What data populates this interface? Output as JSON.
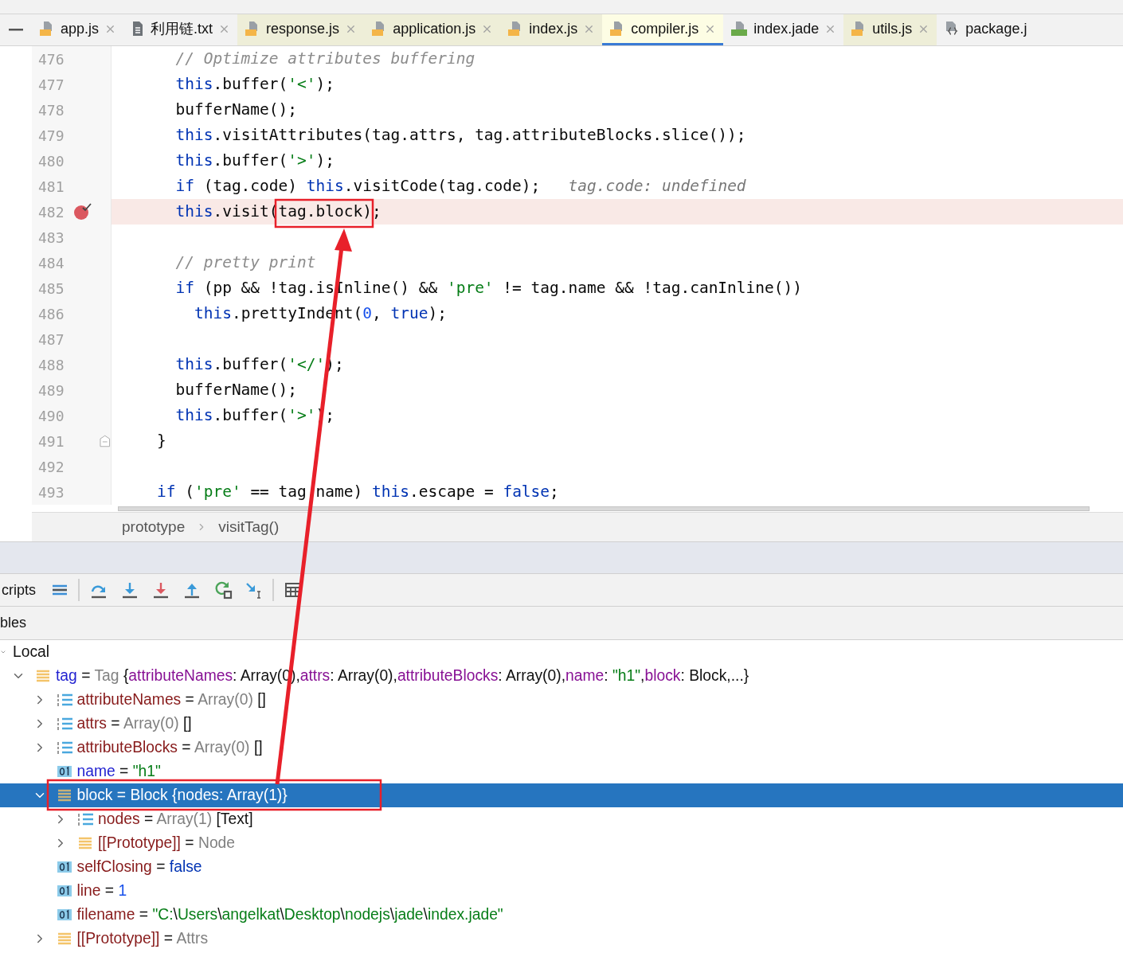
{
  "tabs": [
    {
      "label": "app.js",
      "kind": "js",
      "color": "#f2f2f2",
      "selected": false,
      "closable": true
    },
    {
      "label": "利用链.txt",
      "kind": "txt",
      "color": "#f2f2f2",
      "selected": false,
      "closable": true
    },
    {
      "label": "response.js",
      "kind": "js",
      "color": "#eeeed8",
      "selected": false,
      "closable": true
    },
    {
      "label": "application.js",
      "kind": "js",
      "color": "#eeeed8",
      "selected": false,
      "closable": true
    },
    {
      "label": "index.js",
      "kind": "js",
      "color": "#eeeed8",
      "selected": false,
      "closable": true
    },
    {
      "label": "compiler.js",
      "kind": "js",
      "color": "#fdfde4",
      "selected": true,
      "closable": true
    },
    {
      "label": "index.jade",
      "kind": "jade",
      "color": "#f2f2f2",
      "selected": false,
      "closable": true
    },
    {
      "label": "utils.js",
      "kind": "js",
      "color": "#eeeed8",
      "selected": false,
      "closable": true
    },
    {
      "label": "package.j",
      "kind": "json",
      "color": "#f2f2f2",
      "selected": false,
      "closable": false
    }
  ],
  "code_lines": [
    {
      "number": "476",
      "breakpoint": false,
      "fold": false,
      "segments": [
        {
          "text": "      // Optimize attributes buffering",
          "kind": "comment"
        }
      ]
    },
    {
      "number": "477",
      "breakpoint": false,
      "fold": false,
      "segments": [
        {
          "text": "      this",
          "kind": "keyword"
        },
        {
          "text": ".buffer(",
          "kind": "plain"
        },
        {
          "text": "'<'",
          "kind": "string"
        },
        {
          "text": ");",
          "kind": "plain"
        }
      ]
    },
    {
      "number": "478",
      "breakpoint": false,
      "fold": false,
      "segments": [
        {
          "text": "      bufferName();",
          "kind": "plain"
        }
      ]
    },
    {
      "number": "479",
      "breakpoint": false,
      "fold": false,
      "segments": [
        {
          "text": "      this",
          "kind": "keyword"
        },
        {
          "text": ".visitAttributes(tag.attrs, tag.attributeBlocks.slice());",
          "kind": "plain"
        }
      ]
    },
    {
      "number": "480",
      "breakpoint": false,
      "fold": false,
      "segments": [
        {
          "text": "      this",
          "kind": "keyword"
        },
        {
          "text": ".buffer(",
          "kind": "plain"
        },
        {
          "text": "'>'",
          "kind": "string"
        },
        {
          "text": ");",
          "kind": "plain"
        }
      ]
    },
    {
      "number": "481",
      "breakpoint": false,
      "fold": false,
      "segments": [
        {
          "text": "      if",
          "kind": "keyword"
        },
        {
          "text": " (tag.code) ",
          "kind": "plain"
        },
        {
          "text": "this",
          "kind": "keyword"
        },
        {
          "text": ".visitCode(tag.code);",
          "kind": "plain"
        },
        {
          "text": "   tag.code: undefined",
          "kind": "hint"
        }
      ]
    },
    {
      "number": "482",
      "breakpoint": true,
      "fold": false,
      "segments": [
        {
          "text": "      this",
          "kind": "keyword"
        },
        {
          "text": ".visit(tag.block);",
          "kind": "plain"
        }
      ]
    },
    {
      "number": "483",
      "breakpoint": false,
      "fold": false
    },
    {
      "number": "484",
      "breakpoint": false,
      "fold": false,
      "segments": [
        {
          "text": "      // pretty print",
          "kind": "comment"
        }
      ]
    },
    {
      "number": "485",
      "breakpoint": false,
      "fold": false,
      "segments": [
        {
          "text": "      if",
          "kind": "keyword"
        },
        {
          "text": " (pp && !tag.isInline() && ",
          "kind": "plain"
        },
        {
          "text": "'pre'",
          "kind": "string"
        },
        {
          "text": " != tag.name && !tag.canInline())",
          "kind": "plain"
        }
      ]
    },
    {
      "number": "486",
      "breakpoint": false,
      "fold": false,
      "segments": [
        {
          "text": "        this",
          "kind": "keyword"
        },
        {
          "text": ".prettyIndent(",
          "kind": "plain"
        },
        {
          "text": "0",
          "kind": "number"
        },
        {
          "text": ", ",
          "kind": "plain"
        },
        {
          "text": "true",
          "kind": "keyword"
        },
        {
          "text": ");",
          "kind": "plain"
        }
      ]
    },
    {
      "number": "487",
      "breakpoint": false,
      "fold": false
    },
    {
      "number": "488",
      "breakpoint": false,
      "fold": false,
      "segments": [
        {
          "text": "      this",
          "kind": "keyword"
        },
        {
          "text": ".buffer(",
          "kind": "plain"
        },
        {
          "text": "'</'",
          "kind": "string"
        },
        {
          "text": ");",
          "kind": "plain"
        }
      ]
    },
    {
      "number": "489",
      "breakpoint": false,
      "fold": false,
      "segments": [
        {
          "text": "      bufferName();",
          "kind": "plain"
        }
      ]
    },
    {
      "number": "490",
      "breakpoint": false,
      "fold": false,
      "segments": [
        {
          "text": "      this",
          "kind": "keyword"
        },
        {
          "text": ".buffer(",
          "kind": "plain"
        },
        {
          "text": "'>'",
          "kind": "string"
        },
        {
          "text": ");",
          "kind": "plain"
        }
      ]
    },
    {
      "number": "491",
      "breakpoint": false,
      "fold": true,
      "segments": [
        {
          "text": "    }",
          "kind": "plain"
        }
      ]
    },
    {
      "number": "492",
      "breakpoint": false,
      "fold": false
    },
    {
      "number": "493",
      "breakpoint": false,
      "fold": false,
      "segments": [
        {
          "text": "    if",
          "kind": "keyword"
        },
        {
          "text": " (",
          "kind": "plain"
        },
        {
          "text": "'pre'",
          "kind": "string"
        },
        {
          "text": " == tag.name) ",
          "kind": "plain"
        },
        {
          "text": "this",
          "kind": "keyword"
        },
        {
          "text": ".escape = ",
          "kind": "plain"
        },
        {
          "text": "false",
          "kind": "keyword"
        },
        {
          "text": ";",
          "kind": "plain"
        }
      ]
    }
  ],
  "breadcrumb": [
    "prototype",
    "visitTag()"
  ],
  "frames_label": "cripts",
  "variables_header": "bles",
  "variables": [
    {
      "segments": [
        {
          "text": "Local",
          "kind": "plain"
        }
      ],
      "expanded": true,
      "selected": false,
      "children": [
        {
          "kind": "object",
          "expanded": true,
          "selected": false,
          "segments": [
            {
              "text": "tag",
              "kind": "local"
            },
            {
              "text": " = ",
              "kind": "plain"
            },
            {
              "text": "Tag ",
              "kind": "type"
            },
            {
              "text": "{",
              "kind": "plain"
            },
            {
              "text": "attributeNames",
              "kind": "prop"
            },
            {
              "text": ": Array(0),",
              "kind": "plain"
            },
            {
              "text": "attrs",
              "kind": "prop"
            },
            {
              "text": ": Array(0),",
              "kind": "plain"
            },
            {
              "text": "attributeBlocks",
              "kind": "prop"
            },
            {
              "text": ": Array(0),",
              "kind": "plain"
            },
            {
              "text": "name",
              "kind": "prop"
            },
            {
              "text": ": ",
              "kind": "plain"
            },
            {
              "text": "\"h1\"",
              "kind": "string"
            },
            {
              "text": ",",
              "kind": "plain"
            },
            {
              "text": "block",
              "kind": "prop"
            },
            {
              "text": ": Block,...}",
              "kind": "plain"
            }
          ],
          "children": [
            {
              "kind": "array",
              "expanded": false,
              "selected": false,
              "segments": [
                {
                  "text": "attributeNames",
                  "kind": "var"
                },
                {
                  "text": " = ",
                  "kind": "plain"
                },
                {
                  "text": "Array(0) ",
                  "kind": "type"
                },
                {
                  "text": "[]",
                  "kind": "plain"
                }
              ]
            },
            {
              "kind": "array",
              "expanded": false,
              "selected": false,
              "segments": [
                {
                  "text": "attrs",
                  "kind": "var"
                },
                {
                  "text": " = ",
                  "kind": "plain"
                },
                {
                  "text": "Array(0) ",
                  "kind": "type"
                },
                {
                  "text": "[]",
                  "kind": "plain"
                }
              ]
            },
            {
              "kind": "array",
              "expanded": false,
              "selected": false,
              "segments": [
                {
                  "text": "attributeBlocks",
                  "kind": "var"
                },
                {
                  "text": " = ",
                  "kind": "plain"
                },
                {
                  "text": "Array(0) ",
                  "kind": "type"
                },
                {
                  "text": "[]",
                  "kind": "plain"
                }
              ]
            },
            {
              "kind": "primitive",
              "selected": false,
              "segments": [
                {
                  "text": "name",
                  "kind": "local"
                },
                {
                  "text": " = ",
                  "kind": "plain"
                },
                {
                  "text": "\"h1\"",
                  "kind": "string"
                }
              ]
            },
            {
              "kind": "object",
              "expanded": true,
              "selected": true,
              "segments": [
                {
                  "text": "block",
                  "kind": "var"
                },
                {
                  "text": " = ",
                  "kind": "plain"
                },
                {
                  "text": "Block ",
                  "kind": "type"
                },
                {
                  "text": "{nodes: Array(1)}",
                  "kind": "plain"
                }
              ],
              "children": [
                {
                  "kind": "array",
                  "expanded": false,
                  "selected": false,
                  "segments": [
                    {
                      "text": "nodes",
                      "kind": "var"
                    },
                    {
                      "text": " = ",
                      "kind": "plain"
                    },
                    {
                      "text": "Array(1) ",
                      "kind": "type"
                    },
                    {
                      "text": "[Text]",
                      "kind": "plain"
                    }
                  ]
                },
                {
                  "kind": "object",
                  "expanded": false,
                  "selected": false,
                  "segments": [
                    {
                      "text": "[[Prototype]]",
                      "kind": "var"
                    },
                    {
                      "text": " = ",
                      "kind": "plain"
                    },
                    {
                      "text": "Node",
                      "kind": "type"
                    }
                  ]
                }
              ]
            },
            {
              "kind": "primitive",
              "selected": false,
              "segments": [
                {
                  "text": "selfClosing",
                  "kind": "var"
                },
                {
                  "text": " = ",
                  "kind": "plain"
                },
                {
                  "text": "false",
                  "kind": "keyword"
                }
              ]
            },
            {
              "kind": "primitive",
              "selected": false,
              "segments": [
                {
                  "text": "line",
                  "kind": "var"
                },
                {
                  "text": " = ",
                  "kind": "plain"
                },
                {
                  "text": "1",
                  "kind": "number"
                }
              ]
            },
            {
              "kind": "primitive",
              "selected": false,
              "segments": [
                {
                  "text": "filename",
                  "kind": "var"
                },
                {
                  "text": " = ",
                  "kind": "plain"
                },
                {
                  "text": "\"C:",
                  "kind": "string"
                },
                {
                  "text": "\\",
                  "kind": "plain"
                },
                {
                  "text": "Users",
                  "kind": "string"
                },
                {
                  "text": "\\",
                  "kind": "plain"
                },
                {
                  "text": "angelkat",
                  "kind": "string"
                },
                {
                  "text": "\\",
                  "kind": "plain"
                },
                {
                  "text": "Desktop",
                  "kind": "string"
                },
                {
                  "text": "\\",
                  "kind": "plain"
                },
                {
                  "text": "nodejs",
                  "kind": "string"
                },
                {
                  "text": "\\",
                  "kind": "plain"
                },
                {
                  "text": "jade",
                  "kind": "string"
                },
                {
                  "text": "\\",
                  "kind": "plain"
                },
                {
                  "text": "index.jade\"",
                  "kind": "string"
                }
              ]
            },
            {
              "kind": "object",
              "expanded": false,
              "selected": false,
              "segments": [
                {
                  "text": "[[Prototype]]",
                  "kind": "var"
                },
                {
                  "text": " = ",
                  "kind": "plain"
                },
                {
                  "text": "Attrs",
                  "kind": "type"
                }
              ]
            }
          ]
        }
      ]
    }
  ]
}
